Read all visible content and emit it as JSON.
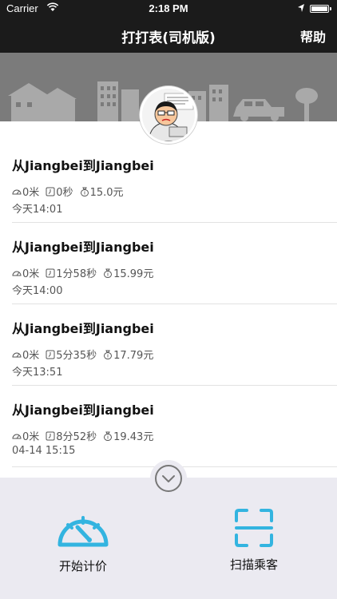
{
  "status_bar": {
    "carrier": "Carrier",
    "time": "2:18 PM"
  },
  "navbar": {
    "title": "打打表(司机版)",
    "help_label": "帮助"
  },
  "trips": [
    {
      "route": "从Jiangbei到Jiangbei",
      "distance": "0米",
      "duration": "0秒",
      "fare": "15.0元",
      "time": "今天14:01"
    },
    {
      "route": "从Jiangbei到Jiangbei",
      "distance": "0米",
      "duration": "1分58秒",
      "fare": "15.99元",
      "time": "今天14:00"
    },
    {
      "route": "从Jiangbei到Jiangbei",
      "distance": "0米",
      "duration": "5分35秒",
      "fare": "17.79元",
      "time": "今天13:51"
    },
    {
      "route": "从Jiangbei到Jiangbei",
      "distance": "0米",
      "duration": "8分52秒",
      "fare": "19.43元",
      "time": "04-14 15:15"
    }
  ],
  "actions": {
    "start_label": "开始计价",
    "scan_label": "扫描乘客"
  },
  "icons": {
    "distance": "odometer-icon",
    "duration": "timer-icon",
    "fare": "money-bag-icon",
    "start": "speedometer-icon",
    "scan": "scan-frame-icon",
    "toggle": "chevron-down-icon"
  },
  "colors": {
    "accent": "#33b4e0",
    "header_bg": "#1b1b1b",
    "panel_bg": "#ebeaf1"
  }
}
